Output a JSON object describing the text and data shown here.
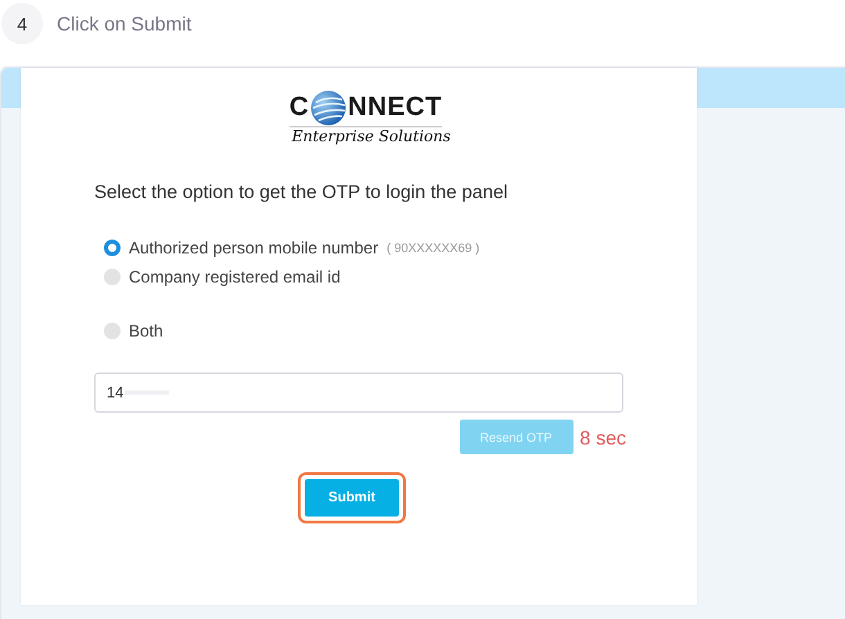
{
  "step": {
    "number": "4",
    "title": "Click on Submit"
  },
  "logo": {
    "left": "C",
    "right": "NNECT",
    "tagline": "Enterprise Solutions"
  },
  "prompt": "Select the option to get the OTP to login the panel",
  "options": [
    {
      "label": "Authorized person mobile number",
      "hint": "( 90XXXXXX69 )",
      "selected": true
    },
    {
      "label": "Company registered email id",
      "selected": false
    },
    {
      "label": "Both",
      "selected": false
    }
  ],
  "otp_field": {
    "value": "14"
  },
  "resend_button": {
    "label": "Resend OTP",
    "disabled": true
  },
  "timer": "8 sec",
  "submit_button": {
    "label": "Submit",
    "highlighted": true
  }
}
